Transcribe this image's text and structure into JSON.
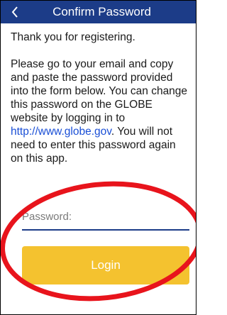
{
  "header": {
    "back_icon": "chevron-left-icon",
    "title": "Confirm Password",
    "background_color": "#1c3c88"
  },
  "body": {
    "thanks_text": "Thank you for registering.",
    "instructions_before_link": "Please go to your email and copy and paste the password provided into the form below. You can change this password on the GLOBE website by logging in to ",
    "link_text": "http://www.globe.gov",
    "instructions_after_link": ". You will not need to enter this password again on this app."
  },
  "form": {
    "password_placeholder": "Password:",
    "password_value": "",
    "login_label": "Login",
    "login_color": "#f4c22f"
  },
  "annotation": {
    "highlight_color": "#e8141c"
  }
}
